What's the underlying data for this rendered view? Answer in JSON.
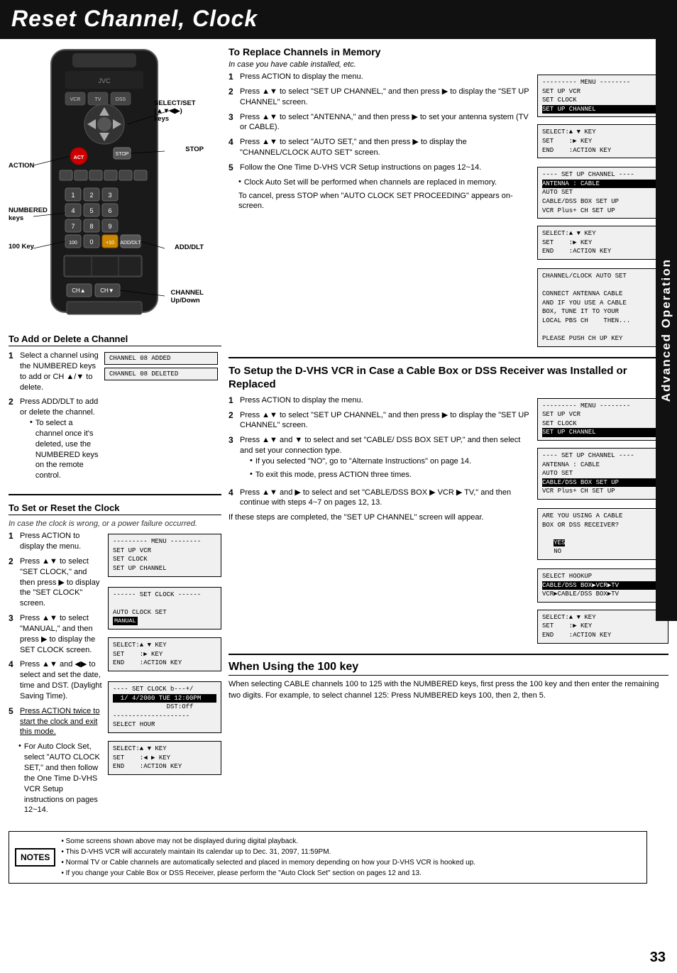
{
  "header": {
    "title": "Reset Channel, Clock"
  },
  "remote": {
    "labels": {
      "select_set": "SELECT/SET",
      "select_set_keys": "(▲▼◀▶)",
      "select_set_suffix": "keys",
      "stop": "STOP",
      "action": "ACTION",
      "numbered": "NUMBERED",
      "numbered_keys": "keys",
      "key_100": "100 Key",
      "add_dlt": "ADD/DLT",
      "channel": "CHANNEL",
      "channel_updown": "Up/Down"
    }
  },
  "add_delete": {
    "title": "To Add or Delete a Channel",
    "steps": [
      {
        "num": "1",
        "text": "Select a channel using the NUMBERED keys to add or CH ▲/▼ to delete."
      },
      {
        "num": "2",
        "text": "Press ADD/DLT to add or delete the channel."
      }
    ],
    "bullet": "To select a channel once it's deleted, use the NUMBERED keys on the remote control.",
    "screens": [
      "CHANNEL 08 ADDED",
      "CHANNEL 08 DELETED"
    ]
  },
  "set_clock": {
    "title": "To Set or Reset the Clock",
    "subtitle": "In case the clock is wrong, or a power failure occurred.",
    "steps": [
      {
        "num": "1",
        "text": "Press ACTION to display the menu."
      },
      {
        "num": "2",
        "text": "Press ▲▼ to select \"SET CLOCK,\" and then press ▶ to display the \"SET CLOCK\" screen."
      },
      {
        "num": "3",
        "text": "Press ▲▼ to select \"MANUAL,\" and then press ▶ to display the SET CLOCK screen."
      },
      {
        "num": "4",
        "text": "Press ▲▼ and ◀▶ to select and set the date, time and DST. (Daylight Saving Time)."
      },
      {
        "num": "5",
        "text": "Press ACTION twice to start the clock and exit this mode."
      }
    ],
    "bullet": "For Auto Clock Set, select \"AUTO CLOCK SET,\" and then follow the One Time D-VHS VCR Setup instructions on pages 12~14.",
    "menu_screen": "--------- MENU --------\nSET UP VCR\nSET CLOCK\nSET UP CHANNEL",
    "set_clock_screen": "------ SET CLOCK ------\n\nAUTO CLOCK SET\nMANUAL",
    "manual_screen": "SELECT:▲ ▼ KEY\nSET    :▶ KEY\nEND    :ACTION KEY",
    "clock_set_screen": "----- SET CLOCK b---+/\n  1/ 4/2000 TUE 12:00PM\n              DST:Off\n--------------------\nSELECT HOUR",
    "clock_keys_screen": "SELECT:▲ ▼ KEY\nSET    :◀ ▶ KEY\nEND    :ACTION KEY"
  },
  "replace_channels": {
    "title": "To Replace Channels in Memory",
    "subtitle": "In case you have cable installed, etc.",
    "steps": [
      {
        "num": "1",
        "text": "Press ACTION to display the menu."
      },
      {
        "num": "2",
        "text": "Press ▲▼ to select \"SET UP CHANNEL,\" and then press ▶ to display the \"SET UP CHANNEL\" screen."
      },
      {
        "num": "3",
        "text": "Press ▲▼ to select \"ANTENNA,\" and then press ▶ to set your antenna system (TV or CABLE)."
      },
      {
        "num": "4",
        "text": "Press ▲▼ to select \"AUTO SET,\" and then press ▶ to display the \"CHANNEL/CLOCK AUTO SET\" screen."
      },
      {
        "num": "5",
        "text": "Follow the One Time D-VHS VCR Setup instructions on pages 12~14."
      }
    ],
    "bullet1": "Clock Auto Set will be performed when channels are replaced in memory.",
    "bullet2": "To cancel, press STOP when \"AUTO CLOCK SET PROCEEDING\" appears on-screen.",
    "menu_screen": "--------- MENU --------\nSET UP VCR\nSET CLOCK\nSET UP CHANNEL",
    "setup_channel_screen": "---- SET UP CHANNEL ----\nANTENNA : CABLE\nAUTO SET\nCABLE/DSS BOX SET UP\nVCR Plus+ CH SET UP",
    "select_keys": "SELECT:▲ ▼ KEY\nSET    :▶ KEY\nEND    :ACTION KEY",
    "channel_clock_screen": "CHANNEL/CLOCK AUTO SET\n\nCONNECT ANTENNA CABLE\nAND IF YOU USE A CABLE\nBOX, TUNE IT TO YOUR\nLOCAL PBS CH    THEN...\n\nPLEASE PUSH CH UP KEY"
  },
  "setup_dvhs": {
    "title": "To Setup the D-VHS VCR in Case a Cable Box or DSS Receiver was Installed or Replaced",
    "steps": [
      {
        "num": "1",
        "text": "Press ACTION to display the menu."
      },
      {
        "num": "2",
        "text": "Press ▲▼ to select \"SET UP CHANNEL,\" and then press ▶ to display the \"SET UP CHANNEL\" screen."
      },
      {
        "num": "3",
        "text": "Press ▲▼ and ▼ to select and set \"CABLE/ DSS BOX SET UP,\" and then select and set your connection type."
      },
      {
        "num": "4",
        "text": "Press ▲▼ and ▶ to select and set \"CABLE/DSS BOX ▶ VCR ▶ TV,\" and then continue with steps 4~7 on pages 12, 13."
      }
    ],
    "bullet1": "If you selected \"NO\", go to \"Alternate Instructions\" on page 14.",
    "bullet2": "To exit this mode, press ACTION three times.",
    "menu_screen": "--------- MENU --------\nSET UP VCR\nSET CLOCK\nSET UP CHANNEL",
    "setup_screen": "---- SET UP CHANNEL ----\nANTENNA : CABLE\nAUTO SET\nCABLE/DSS BOX SET UP\nVCR Plus+ CH SET UP",
    "cable_question": "ARE YOU USING A CABLE\nBOX OR DSS RECEIVER?\n\n    YES\n    NO",
    "hookup_screen": "SELECT HOOKUP\nCABLE/DSS BOX▶VCR▶TV\nVCR▶CABLE/DSS BOX▶TV",
    "keys_screen": "SELECT:▲ ▼ KEY\nSET    :▶ KEY\nEND    :ACTION KEY",
    "complete_text": "If these steps are completed, the \"SET UP CHANNEL\" screen will appear."
  },
  "when_100": {
    "title": "When Using the 100 key",
    "text": "When selecting CABLE channels 100 to 125 with the NUMBERED keys, first press the 100 key and then enter the remaining two digits.\nFor example, to select channel 125:\nPress NUMBERED keys 100, then 2, then 5."
  },
  "notes": {
    "label": "NOTES",
    "items": [
      "Some screens shown above may not be displayed during digital playback.",
      "This D-VHS VCR will accurately maintain its calendar up to Dec. 31, 2097, 11:59PM.",
      "Normal TV or Cable channels are automatically selected and placed in memory depending on how your D-VHS VCR is hooked up.",
      "If you change your Cable Box or DSS Receiver, please perform the \"Auto Clock Set\" section on pages 12 and 13."
    ]
  },
  "advanced_operation": {
    "label": "Advanced Operation"
  },
  "page_number": "33"
}
